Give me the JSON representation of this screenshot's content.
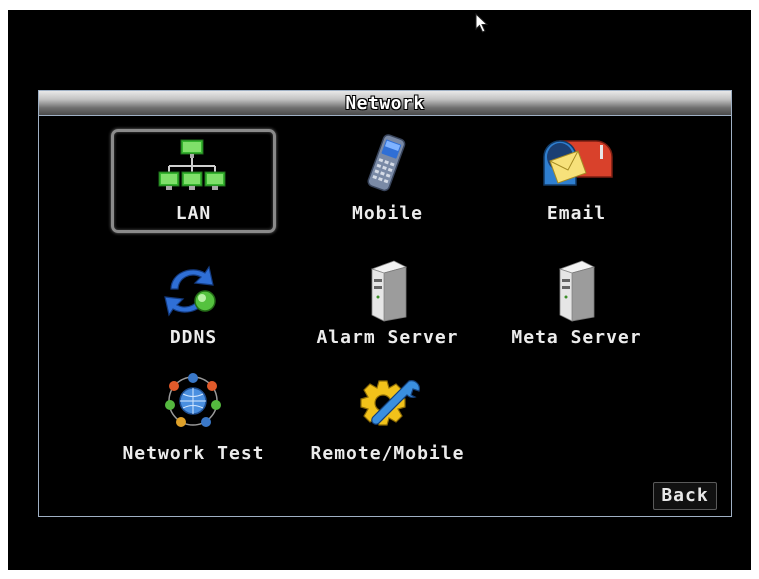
{
  "dialog": {
    "title": "Network"
  },
  "items": [
    {
      "label": "LAN",
      "icon": "lan-network-icon"
    },
    {
      "label": "Mobile",
      "icon": "mobile-phone-icon"
    },
    {
      "label": "Email",
      "icon": "mailbox-icon"
    },
    {
      "label": "DDNS",
      "icon": "ddns-refresh-icon"
    },
    {
      "label": "Alarm Server",
      "icon": "server-icon"
    },
    {
      "label": "Meta Server",
      "icon": "server-icon"
    },
    {
      "label": "Network Test",
      "icon": "network-test-icon"
    },
    {
      "label": "Remote/Mobile",
      "icon": "gear-wrench-icon"
    }
  ],
  "selected_item": "LAN",
  "back_label": "Back",
  "colors": {
    "screen_background": "#000000",
    "dialog_border": "#9fb0c4",
    "label_text": "#ececec",
    "lan_icon": "#2fae2a",
    "selection_border": "#8a8a8a"
  }
}
